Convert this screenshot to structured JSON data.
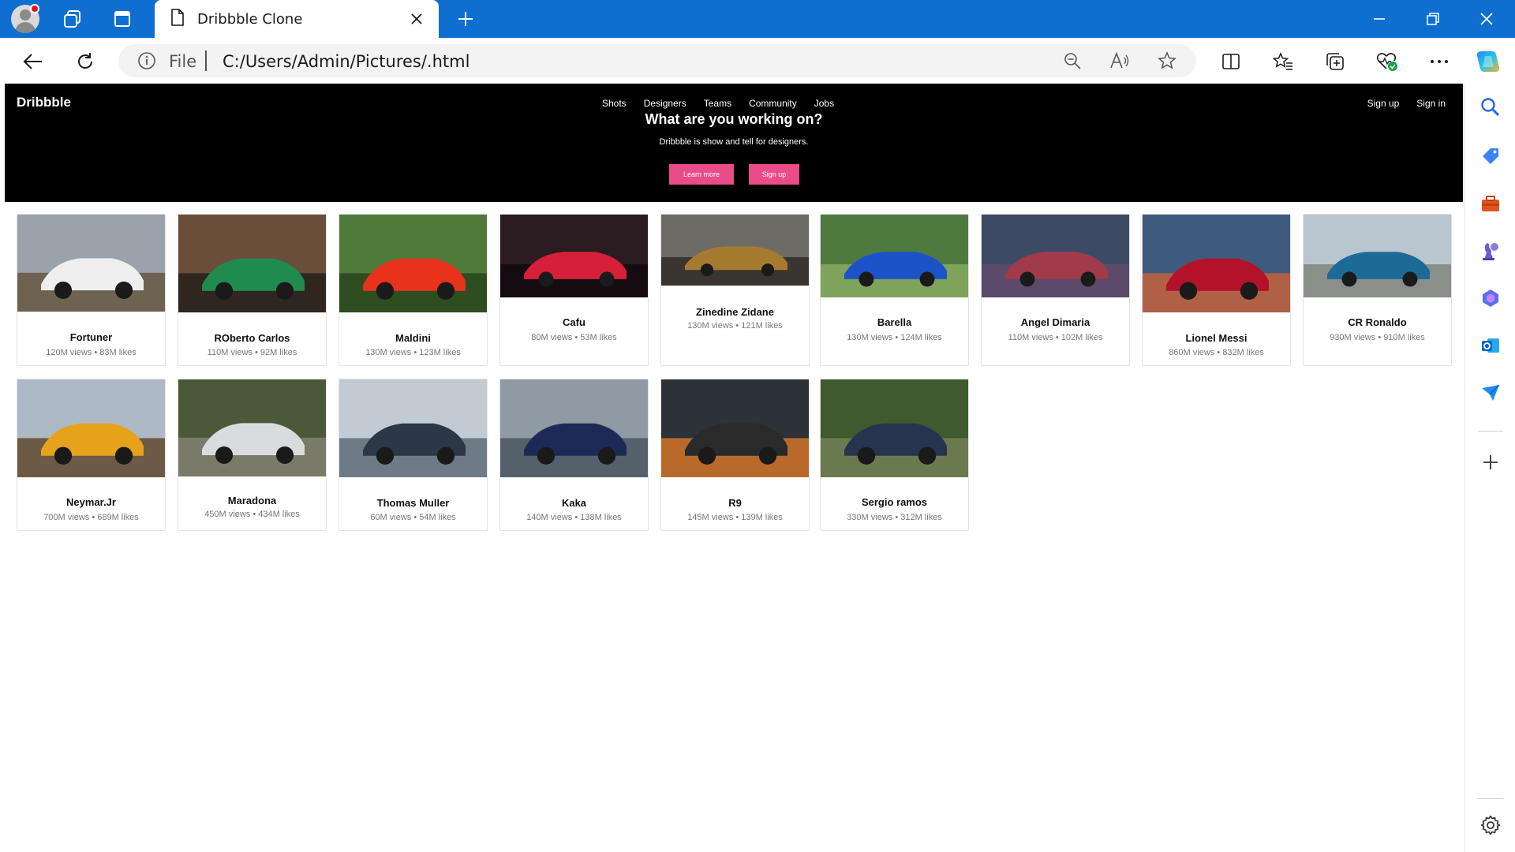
{
  "browser": {
    "tab_title": "Dribbble Clone",
    "address_scheme": "File",
    "address_url": "C:/Users/Admin/Pictures/.html"
  },
  "site": {
    "logo": "Dribbble",
    "nav": [
      "Shots",
      "Designers",
      "Teams",
      "Community",
      "Jobs"
    ],
    "auth": [
      "Sign up",
      "Sign in"
    ],
    "hero_title": "What are you working on?",
    "hero_subtitle": "Dribbble is show and tell for designers.",
    "learn_more": "Learn more",
    "sign_up": "Sign up",
    "accent_color": "#ea4c89"
  },
  "cards": [
    {
      "title": "Fortuner",
      "stats": "120M views • 83M likes",
      "palette": [
        "#9aa3ab",
        "#6e6350",
        "#eeeeee"
      ]
    },
    {
      "title": "ROberto Carlos",
      "stats": "110M views • 92M likes",
      "palette": [
        "#6b4e3a",
        "#2f2620",
        "#1f8b4f"
      ]
    },
    {
      "title": "Maldini",
      "stats": "130M views • 123M likes",
      "palette": [
        "#4f7a3a",
        "#2e4d20",
        "#e8321c"
      ]
    },
    {
      "title": "Cafu",
      "stats": "80M views • 53M likes",
      "palette": [
        "#2a1c20",
        "#140c10",
        "#d6203a"
      ]
    },
    {
      "title": "Zinedine Zidane",
      "stats": "130M views • 121M likes",
      "palette": [
        "#6d6b66",
        "#3a3530",
        "#a57b2f"
      ]
    },
    {
      "title": "Barella",
      "stats": "130M views • 124M likes",
      "palette": [
        "#4f7a3f",
        "#7fa35a",
        "#1d53c9"
      ]
    },
    {
      "title": "Angel Dimaria",
      "stats": "110M views • 102M likes",
      "palette": [
        "#3d4a66",
        "#5b4a6a",
        "#a13a4a"
      ]
    },
    {
      "title": "Lionel Messi",
      "stats": "860M views • 832M likes",
      "palette": [
        "#3e5a7c",
        "#b06045",
        "#b3122a"
      ]
    },
    {
      "title": "CR Ronaldo",
      "stats": "930M views • 910M likes",
      "palette": [
        "#b9c6cf",
        "#8a8f8a",
        "#1d6a96"
      ]
    },
    {
      "title": "Neymar.Jr",
      "stats": "700M views • 689M likes",
      "palette": [
        "#aeb9c6",
        "#6d5a45",
        "#e6a21a"
      ]
    },
    {
      "title": "Maradona",
      "stats": "450M views • 434M likes",
      "palette": [
        "#4a5a38",
        "#7a7a68",
        "#d9dcdf"
      ]
    },
    {
      "title": "Thomas Muller",
      "stats": "60M views • 54M likes",
      "palette": [
        "#c2cbd4",
        "#6e7a86",
        "#2c3848"
      ]
    },
    {
      "title": "Kaka",
      "stats": "140M views • 138M likes",
      "palette": [
        "#8f9aa4",
        "#55606a",
        "#1e2a56"
      ]
    },
    {
      "title": "R9",
      "stats": "145M views • 139M likes",
      "palette": [
        "#2d3238",
        "#b96a2a",
        "#2a2a2a"
      ]
    },
    {
      "title": "Sergio ramos",
      "stats": "330M views • 312M likes",
      "palette": [
        "#3e5a2e",
        "#6a7a4e",
        "#26344f"
      ]
    }
  ]
}
